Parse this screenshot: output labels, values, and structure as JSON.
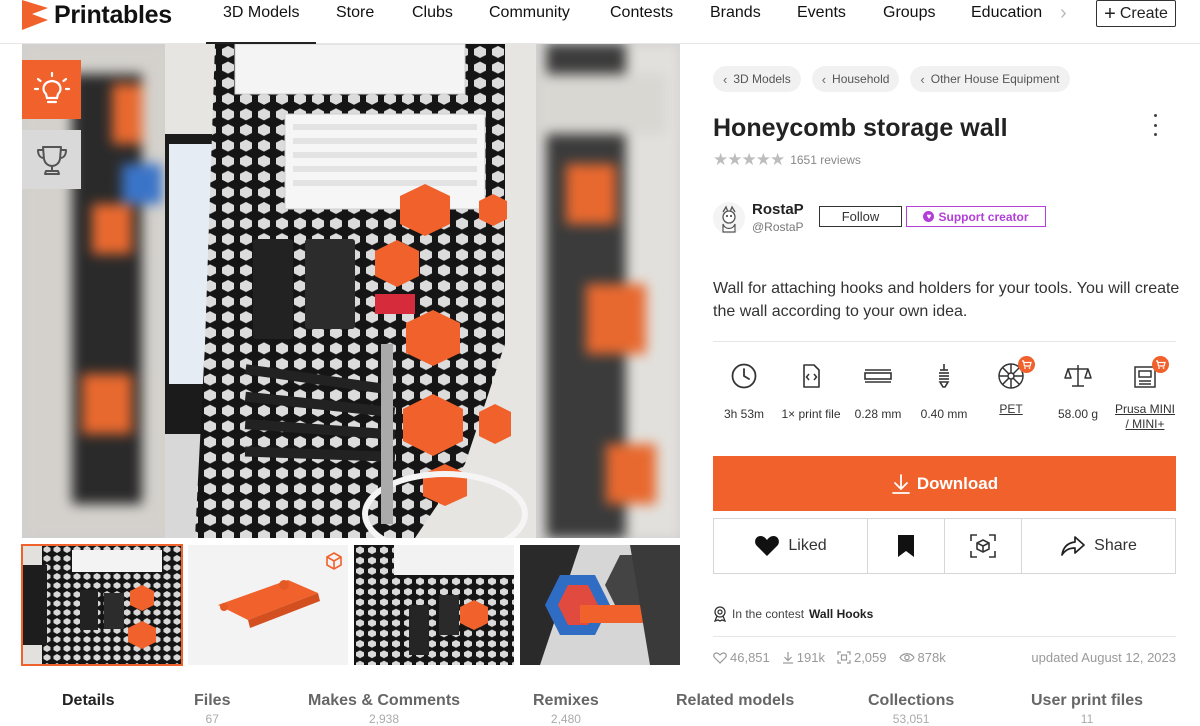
{
  "app": {
    "name": "Printables"
  },
  "nav": {
    "items": [
      "3D Models",
      "Store",
      "Clubs",
      "Community",
      "Contests",
      "Brands",
      "Events",
      "Groups",
      "Education"
    ],
    "create_label": "Create"
  },
  "breadcrumbs": [
    "3D Models",
    "Household",
    "Other House Equipment"
  ],
  "model": {
    "title": "Honeycomb storage wall",
    "rating": 4.5,
    "reviews": "1651 reviews",
    "description": "Wall for attaching hooks and holders for your tools. You will create the wall according to your own idea."
  },
  "creator": {
    "name": "RostaP",
    "handle": "@RostaP",
    "follow_label": "Follow",
    "support_label": "Support creator"
  },
  "params": [
    {
      "icon": "clock-icon",
      "label": "3h 53m"
    },
    {
      "icon": "file-code-icon",
      "label": "1× print file"
    },
    {
      "icon": "layer-height-icon",
      "label": "0.28 mm"
    },
    {
      "icon": "nozzle-icon",
      "label": "0.40 mm"
    },
    {
      "icon": "filament-spool-icon",
      "label": "PET",
      "link": true
    },
    {
      "icon": "scale-icon",
      "label": "58.00 g"
    },
    {
      "icon": "printer-icon",
      "label": "Prusa MINI / MINI+",
      "link": true
    }
  ],
  "actions": {
    "download_label": "Download",
    "liked_label": "Liked",
    "share_label": "Share"
  },
  "contest": {
    "prefix": "In the contest",
    "name": "Wall Hooks"
  },
  "stats": {
    "likes": "46,851",
    "downloads": "191k",
    "makes": "2,059",
    "views": "878k",
    "updated": "updated August 12, 2023"
  },
  "tabs": [
    {
      "label": "Details",
      "count": ""
    },
    {
      "label": "Files",
      "count": "67"
    },
    {
      "label": "Makes & Comments",
      "count": "2,938"
    },
    {
      "label": "Remixes",
      "count": "2,480"
    },
    {
      "label": "Related models",
      "count": ""
    },
    {
      "label": "Collections",
      "count": "53,051"
    },
    {
      "label": "User print files",
      "count": "11"
    }
  ],
  "colors": {
    "accent": "#f0612b",
    "support": "#b13fd8"
  }
}
